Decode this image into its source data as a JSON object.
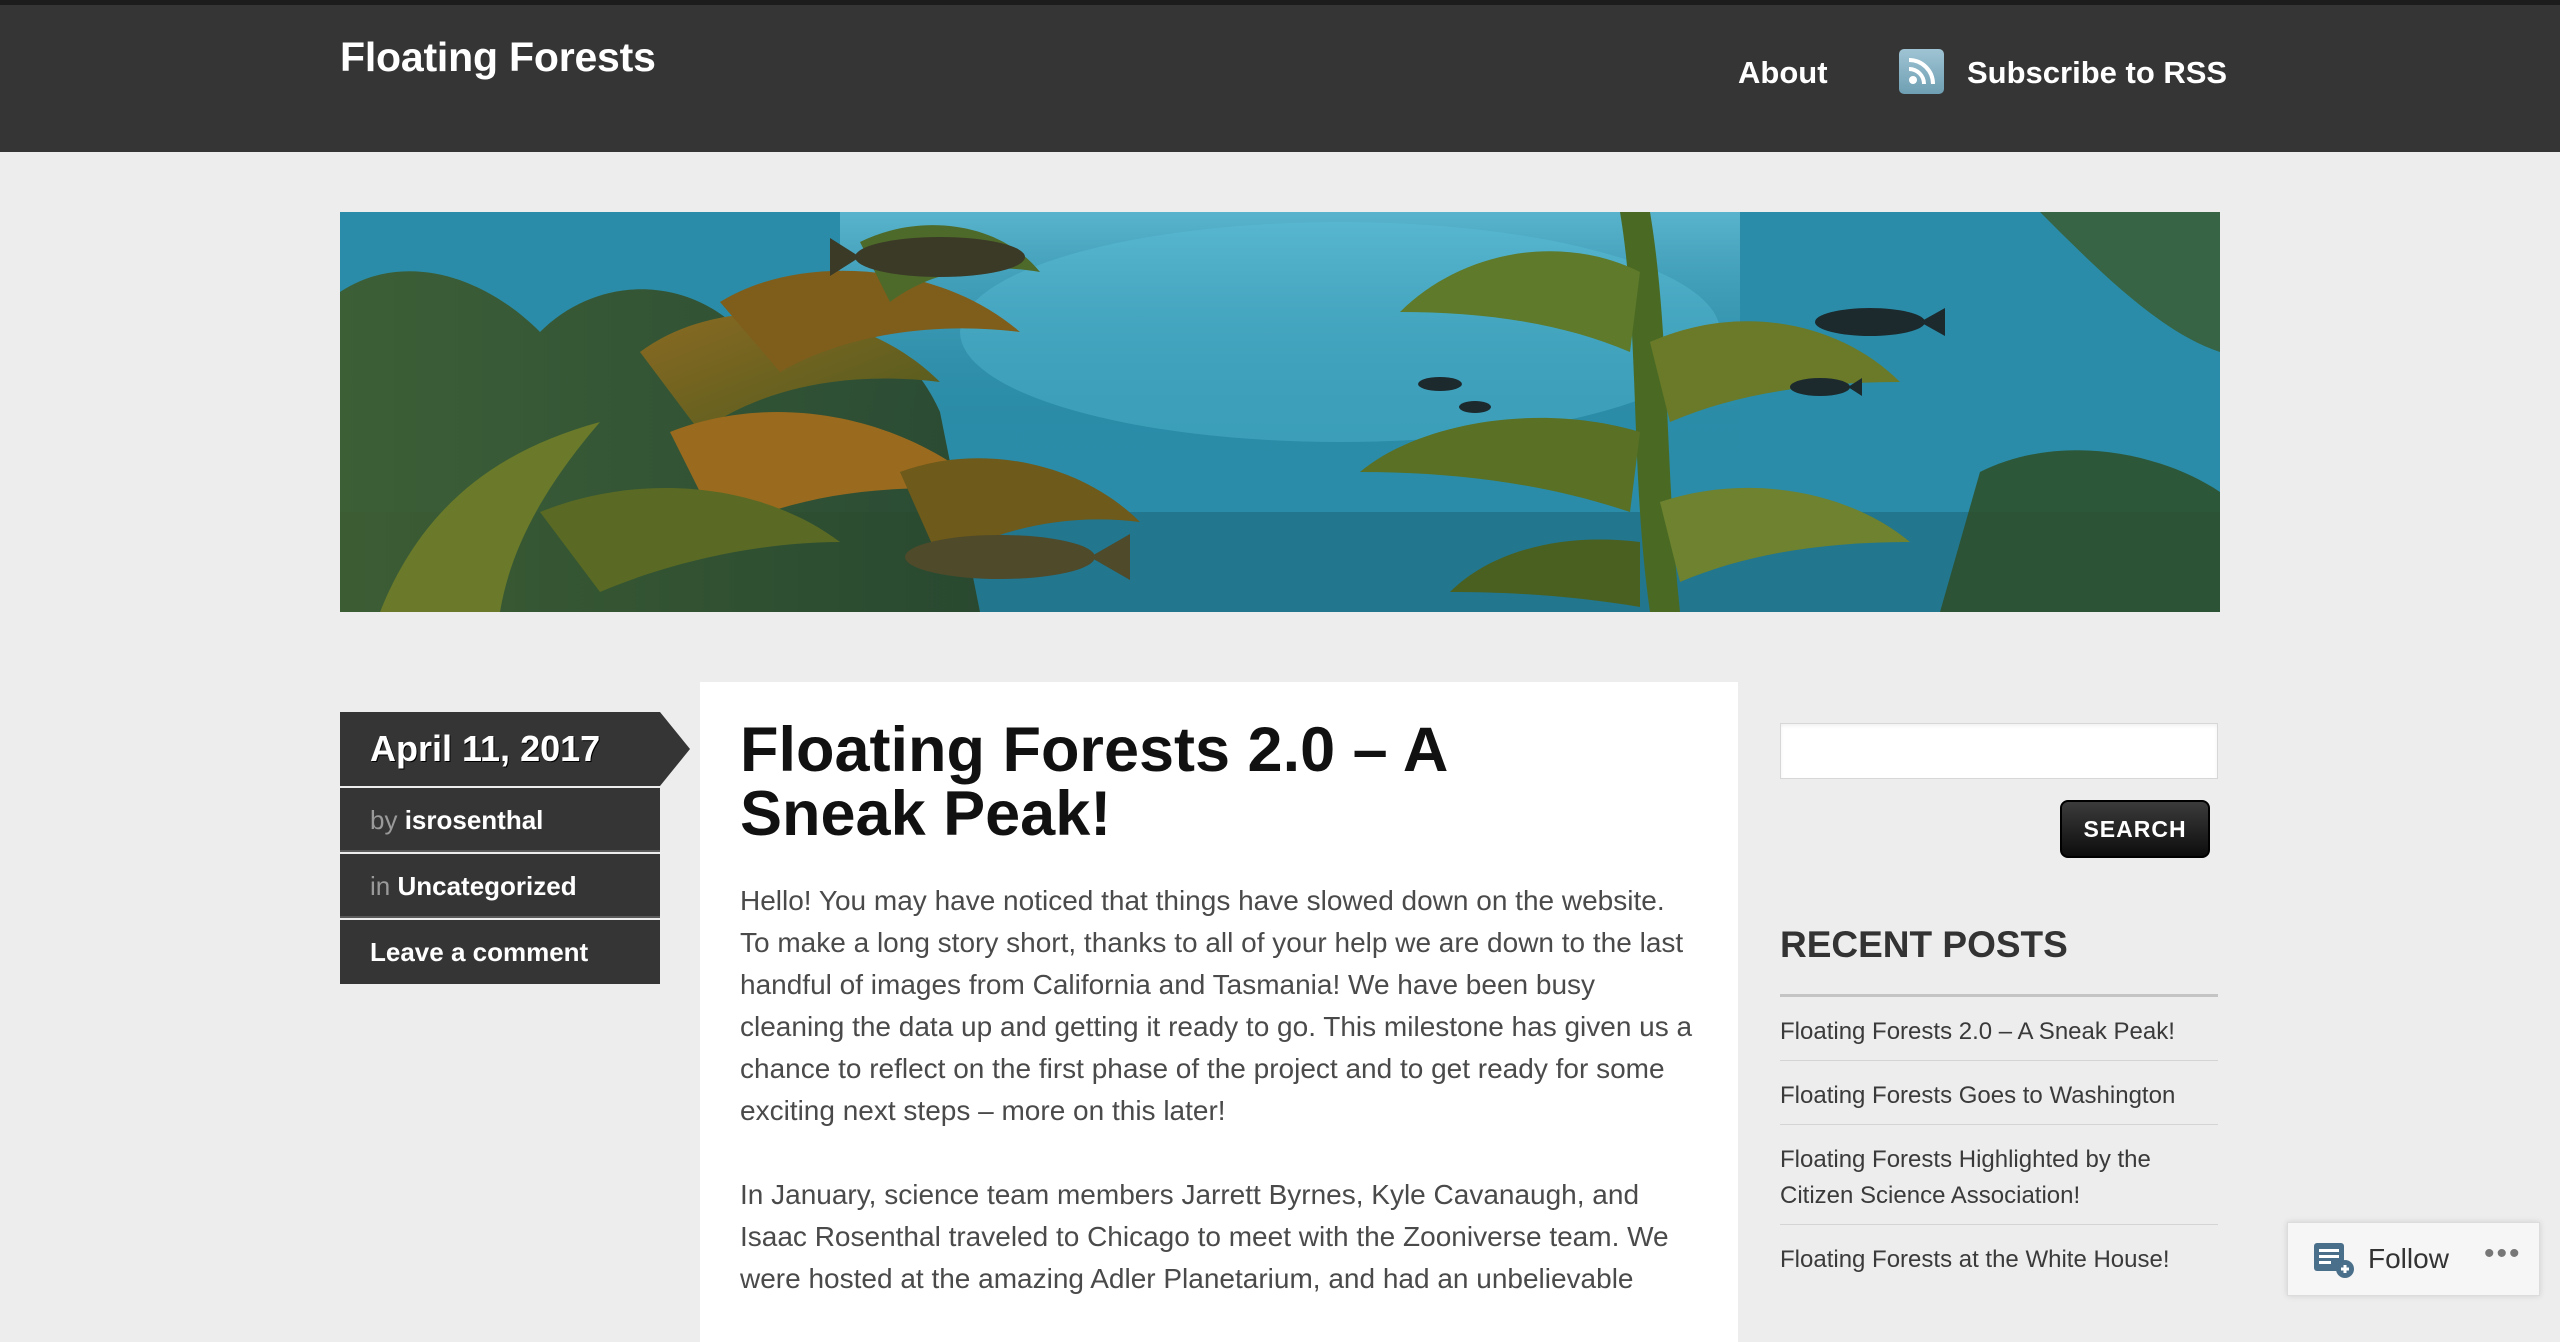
{
  "site": {
    "title": "Floating Forests"
  },
  "nav": {
    "about": "About",
    "rss": "Subscribe to RSS"
  },
  "post": {
    "date": "April 11, 2017",
    "meta": {
      "by_prefix": "by",
      "author": "isrosenthal",
      "in_prefix": "in",
      "category": "Uncategorized",
      "comment": "Leave a comment"
    },
    "title": "Floating Forests 2.0 – A Sneak Peak!",
    "paragraphs": [
      "Hello! You may have noticed that things have slowed down on the website. To make a long story short, thanks to all of your help we are down to the last handful of images from California and Tasmania! We have been busy cleaning the data up and getting it ready to go. This milestone has given us a chance to reflect on the first phase of the project and to get ready for some exciting next steps – more on this later!",
      "In January, science team members Jarrett Byrnes, Kyle Cavanaugh, and Isaac Rosenthal traveled to Chicago to meet with the Zooniverse team. We were hosted at the amazing Adler Planetarium, and had an unbelievable"
    ]
  },
  "sidebar": {
    "search_button": "SEARCH",
    "recent_title": "RECENT POSTS",
    "recent_posts": [
      "Floating Forests 2.0 – A Sneak Peak!",
      "Floating Forests Goes to Washington",
      "Floating Forests Highlighted by the Citizen Science Association!",
      "Floating Forests at the White House!"
    ]
  },
  "follow": {
    "label": "Follow",
    "more": "•••"
  },
  "colors": {
    "header_bg": "#353535",
    "page_bg": "#ededed",
    "meta_bg": "#353535",
    "banner_water": "#2f9fbb"
  }
}
